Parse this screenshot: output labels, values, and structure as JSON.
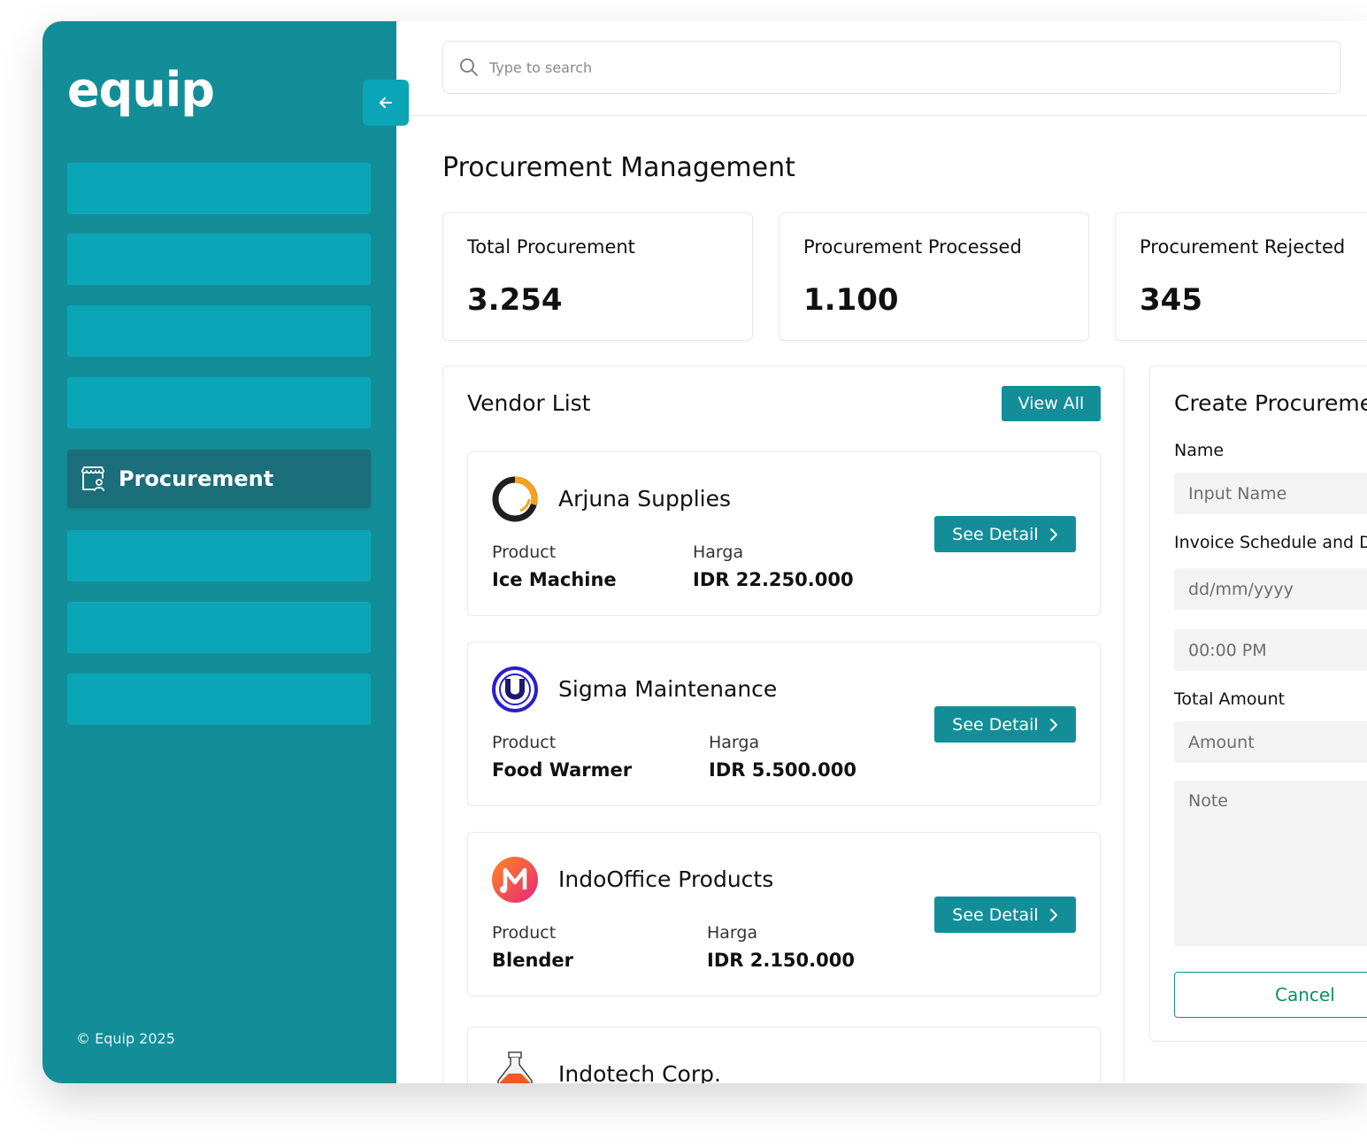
{
  "app": {
    "logo": "equip",
    "copyright": "© Equip 2025",
    "accent_color": "#138e99",
    "accent_light": "#0aa6b7"
  },
  "sidebar": {
    "active_item": {
      "label": "Procurement",
      "icon": "store-user-icon"
    },
    "collapse_icon": "arrow-left-icon"
  },
  "search": {
    "placeholder": "Type to search",
    "icon": "search-icon"
  },
  "page": {
    "title": "Procurement Management"
  },
  "stats": [
    {
      "label": "Total Procurement",
      "value": "3.254"
    },
    {
      "label": "Procurement Processed",
      "value": "1.100"
    },
    {
      "label": "Procurement Rejected",
      "value": "345"
    }
  ],
  "vendor_list": {
    "title": "Vendor List",
    "view_all_label": "View All",
    "product_label": "Product",
    "price_label": "Harga",
    "see_detail_label": "See Detail",
    "vendors": [
      {
        "name": "Arjuna Supplies",
        "product": "Ice Machine",
        "price": "IDR 22.250.000",
        "logo": "ring-logo-icon"
      },
      {
        "name": "Sigma Maintenance",
        "product": "Food Warmer",
        "price": "IDR 5.500.000",
        "logo": "u-circle-logo-icon"
      },
      {
        "name": "IndoOffice Products",
        "product": "Blender",
        "price": "IDR 2.150.000",
        "logo": "music-m-logo-icon"
      },
      {
        "name": "Indotech Corp.",
        "logo": "flask-logo-icon"
      }
    ]
  },
  "create_form": {
    "title": "Create Procurement",
    "name_label": "Name",
    "name_placeholder": "Input Name",
    "schedule_label": "Invoice Schedule and Date",
    "date_placeholder": "dd/mm/yyyy",
    "time_placeholder": "00:00 PM",
    "amount_label": "Total Amount",
    "amount_placeholder": "Amount",
    "note_placeholder": "Note",
    "cancel_label": "Cancel"
  }
}
